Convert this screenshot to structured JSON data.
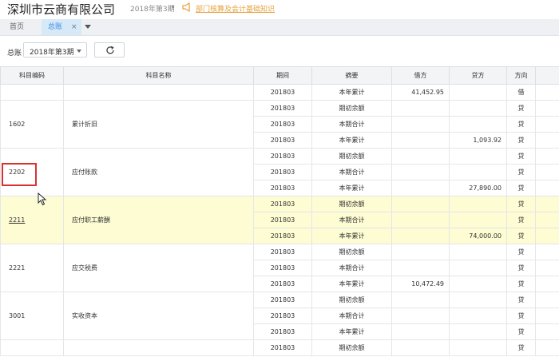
{
  "header": {
    "company": "深圳市云商有限公司",
    "period": "2018年第3期",
    "notice": "部门核算及会计基础知识"
  },
  "tabs": [
    {
      "label": "首页"
    },
    {
      "label": "总账",
      "close": "×"
    }
  ],
  "toolbar": {
    "label": "总账",
    "period_value": "2018年第3期"
  },
  "table": {
    "columns": [
      "科目编码",
      "科目名称",
      "期间",
      "摘要",
      "借方",
      "贷方",
      "方向"
    ],
    "groups": [
      {
        "code": "",
        "name": "",
        "highlight": false,
        "rows": [
          {
            "period": "201803",
            "summary": "本年累计",
            "debit": "41,452.95",
            "credit": "",
            "dir": "借"
          }
        ]
      },
      {
        "code": "1602",
        "name": "累计折旧",
        "highlight": false,
        "rows": [
          {
            "period": "201803",
            "summary": "期初余额",
            "debit": "",
            "credit": "",
            "dir": "贷"
          },
          {
            "period": "201803",
            "summary": "本期合计",
            "debit": "",
            "credit": "",
            "dir": "贷"
          },
          {
            "period": "201803",
            "summary": "本年累计",
            "debit": "",
            "credit": "1,093.92",
            "dir": "贷"
          }
        ]
      },
      {
        "code": "2202",
        "name": "应付账款",
        "highlight": false,
        "rows": [
          {
            "period": "201803",
            "summary": "期初余额",
            "debit": "",
            "credit": "",
            "dir": "贷"
          },
          {
            "period": "201803",
            "summary": "本期合计",
            "debit": "",
            "credit": "",
            "dir": "贷"
          },
          {
            "period": "201803",
            "summary": "本年累计",
            "debit": "",
            "credit": "27,890.00",
            "dir": "贷"
          }
        ]
      },
      {
        "code": "2211",
        "name": "应付职工薪酬",
        "highlight": true,
        "rows": [
          {
            "period": "201803",
            "summary": "期初余额",
            "debit": "",
            "credit": "",
            "dir": "贷"
          },
          {
            "period": "201803",
            "summary": "本期合计",
            "debit": "",
            "credit": "",
            "dir": "贷"
          },
          {
            "period": "201803",
            "summary": "本年累计",
            "debit": "",
            "credit": "74,000.00",
            "dir": "贷"
          }
        ]
      },
      {
        "code": "2221",
        "name": "应交税费",
        "highlight": false,
        "rows": [
          {
            "period": "201803",
            "summary": "期初余额",
            "debit": "",
            "credit": "",
            "dir": "贷"
          },
          {
            "period": "201803",
            "summary": "本期合计",
            "debit": "",
            "credit": "",
            "dir": "贷"
          },
          {
            "period": "201803",
            "summary": "本年累计",
            "debit": "10,472.49",
            "credit": "",
            "dir": "贷"
          }
        ]
      },
      {
        "code": "3001",
        "name": "实收资本",
        "highlight": false,
        "rows": [
          {
            "period": "201803",
            "summary": "期初余额",
            "debit": "",
            "credit": "",
            "dir": "贷"
          },
          {
            "period": "201803",
            "summary": "本期合计",
            "debit": "",
            "credit": "",
            "dir": "贷"
          },
          {
            "period": "201803",
            "summary": "本年累计",
            "debit": "",
            "credit": "",
            "dir": "贷"
          }
        ]
      },
      {
        "code": "",
        "name": "",
        "highlight": false,
        "rows": [
          {
            "period": "201803",
            "summary": "期初余额",
            "debit": "",
            "credit": "",
            "dir": "贷"
          }
        ]
      }
    ]
  },
  "colors": {
    "accent": "#3c8dde",
    "notice": "#e6a23c",
    "row_highlight": "#fdfcd3",
    "annotation_box": "#d9332f"
  }
}
